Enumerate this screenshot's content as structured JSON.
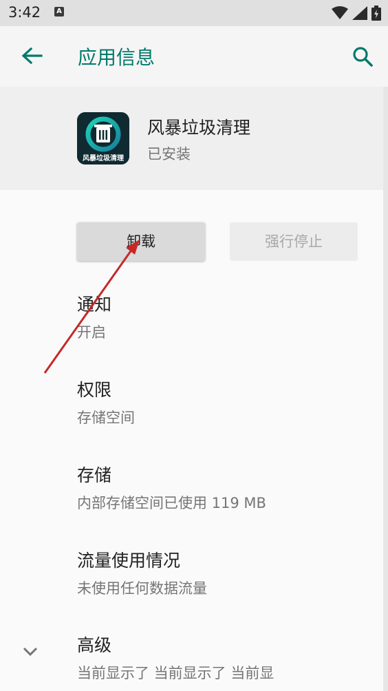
{
  "status": {
    "time": "3:42",
    "notif_badge": "A"
  },
  "toolbar": {
    "title": "应用信息"
  },
  "app": {
    "name": "风暴垃圾清理",
    "status": "已安装",
    "icon_caption": "风暴垃圾清理"
  },
  "buttons": {
    "uninstall": "卸载",
    "force_stop": "强行停止"
  },
  "items": [
    {
      "title": "通知",
      "subtitle": "开启"
    },
    {
      "title": "权限",
      "subtitle": "存储空间"
    },
    {
      "title": "存储",
      "subtitle": "内部存储空间已使用 119 MB"
    },
    {
      "title": "流量使用情况",
      "subtitle": "未使用任何数据流量"
    },
    {
      "title": "高级",
      "subtitle": "当前显示了 当前显示了 当前显"
    }
  ],
  "colors": {
    "accent": "#00796b",
    "annotation_arrow": "#c62828"
  },
  "icons": [
    "back-arrow-icon",
    "search-icon",
    "wifi-icon",
    "signal-icon",
    "battery-icon",
    "chevron-down-icon",
    "trash-icon"
  ]
}
